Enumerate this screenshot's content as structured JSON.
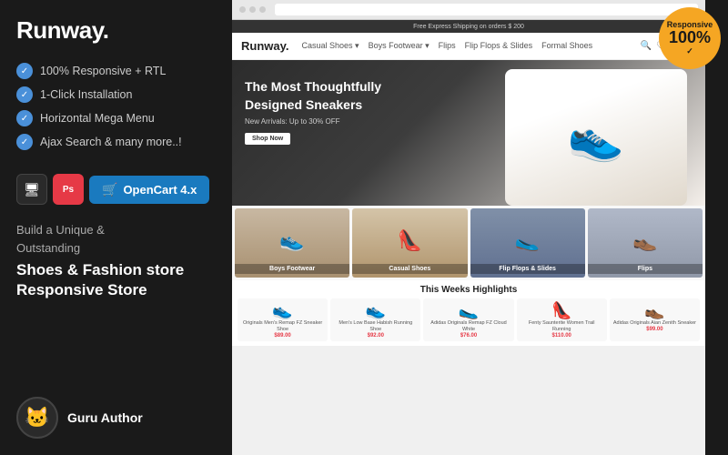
{
  "left": {
    "logo": "Runway.",
    "features": [
      "100% Responsive + RTL",
      "1-Click Installation",
      "Horizontal Mega Menu",
      "Ajax Search & many more..!"
    ],
    "opencart_label": "OpenCart 4.x",
    "tagline": "Build a Unique & Outstanding",
    "store_title": "Shoes & Fashion store\nResponsive Store",
    "author_name": "Guru Author"
  },
  "preview": {
    "store_logo": "Runway.",
    "nav_items": [
      "Casual Shoes",
      "Boys Footwear",
      "Flips",
      "Flip Flops & Slides",
      "Formal Shoes"
    ],
    "hero_title": "The Most Thoughtfully Designed Sneakers",
    "hero_sub": "New Arrivals: Up to 30% OFF",
    "hero_btn": "Shop Now",
    "categories": [
      {
        "label": "Boys Footwear",
        "bg": 1
      },
      {
        "label": "Casual Shoes",
        "bg": 2
      },
      {
        "label": "Flip Flops & Slides",
        "bg": 3
      },
      {
        "label": "Flips",
        "bg": 4
      }
    ],
    "highlights_title": "This Weeks Highlights",
    "highlights": [
      {
        "name": "Originals Men's Remap FZ Sneaker Shoe",
        "price": "$89.00"
      },
      {
        "name": "Men's Low Base Habish Running Shoe",
        "price": "$92.00"
      },
      {
        "name": "Adidas Originals Remap FZ Cloud White",
        "price": "$76.00"
      },
      {
        "name": "Fenty Saunterite Women Trail Running",
        "price": "$110.00"
      },
      {
        "name": "Adidas Originals Aian Zenith Sneaker",
        "price": "$99.00"
      }
    ]
  },
  "badge": {
    "line1": "Responsive",
    "line2": "100%"
  }
}
